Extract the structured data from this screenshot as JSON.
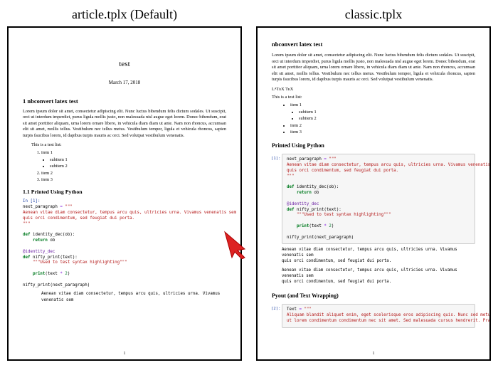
{
  "left": {
    "label": "article.tplx (Default)",
    "title": "test",
    "date": "March 17, 2018",
    "h1": "1   nbconvert latex test",
    "para": "Lorem ipsum dolor sit amet, consectetur adipiscing elit. Nunc luctus bibendum felis dictum sodales. Ut suscipit, orci ut interdum imperdiet, purus ligula mollis justo, non malesuada nisl augue eget lorem. Donec bibendum, erat sit amet porttitor aliquam, urna lorem ornare libero, in vehicula diam diam ut ante. Nam non rhoncus, accumsan elit sit amet, mollis tellus. Vestibulum nec tellus metus. Vestibulum tempor, ligula et vehicula rhoncus, sapien turpis faucibus lorem, id dapibus turpis mauris ac orci. Sed volutpat vestibulum venenatis.",
    "listLabel": "This is a test list:",
    "item1": "item 1",
    "sub1": "subitem 1",
    "sub2": "subitem 2",
    "item2": "item 2",
    "item3": "item 3",
    "h2": "1.1   Printed Using Python",
    "prompt": "In [1]:",
    "code": {
      "l01a": "next_paragraph ",
      "l01b": "=",
      "l01c": " \"\"\"",
      "l02": "Aenean vitae diam consectetur, tempus arcu quis, ultricies urna. Vivamus venenatis sem",
      "l03": "quis orci condimentum, sed feugiat dui porta.",
      "l04": "\"\"\"",
      "l06a": "def",
      "l06b": " identity_dec(ob):",
      "l07a": "    return",
      "l07b": " ob",
      "l09": "@identity_dec",
      "l10a": "def",
      "l10b": " nifty_print(text):",
      "l11": "    \"\"\"Used to test syntax highlighting\"\"\"",
      "l13a": "    print",
      "l13b": "(text ",
      "l13c": "*",
      "l13d": " ",
      "l13e": "2",
      "l13f": ")",
      "l15": "nifty_print(next_paragraph)"
    },
    "output": "Aenean vitae diam consectetur, tempus arcu quis, ultricies urna. Vivamus venenatis sem",
    "pageNum": "1"
  },
  "right": {
    "label": "classic.tplx",
    "h1": "nbconvert latex test",
    "para": "Lorem ipsum dolor sit amet, consectetur adipiscing elit. Nunc luctus bibendum felis dictum sodales. Ut suscipit, orci ut interdum imperdiet, purus ligula mollis justo, non malesuada nisl augue eget lorem. Donec bibendum, erat sit amet porttitor aliquam, urna lorem ornare libero, in vehicula diam diam ut ante. Nam non rhoncus, accumsan elit sit amet, mollis tellus. Vestibulum nec tellus metus. Vestibulum tempor, ligula et vehicula rhoncus, sapien turpis faucibus lorem, id dapibus turpis mauris ac orci. Sed volutpat vestibulum venenatis.",
    "latex": "LᴬTᴇX TᴇX",
    "listLabel": "This is a test list:",
    "item1": "item 1",
    "sub1": "subitem 1",
    "sub2": "subitem 2",
    "item2": "item 2",
    "item3": "item 3",
    "h2": "Printed Using Python",
    "prompt1": "[1]:",
    "code": {
      "l01a": "next_paragraph ",
      "l01b": "=",
      "l01c": " \"\"\"",
      "l02": "Aenean vitae diam consectetur, tempus arcu quis, ultricies urna. Vivamus venenatis sem",
      "l03": "quis orci condimentum, sed feugiat dui porta.",
      "l04": "\"\"\"",
      "l06a": "def",
      "l06b": " identity_dec(ob):",
      "l07a": "    return",
      "l07b": " ob",
      "l09": "@identity_dec",
      "l10a": "def",
      "l10b": " nifty_print(text):",
      "l11": "    \"\"\"Used to test syntax highlighting\"\"\"",
      "l13a": "    print",
      "l13b": "(text ",
      "l13c": "*",
      "l13d": " ",
      "l13e": "2",
      "l13f": ")",
      "l15": "nifty_print(next_paragraph)"
    },
    "out1": "Aenean vitae diam consectetur, tempus arcu quis, ultricies urna. Vivamus venenatis sem\nquis orci condimentum, sed feugiat dui porta.",
    "out2": "Aenean vitae diam consectetur, tempus arcu quis, ultricies urna. Vivamus venenatis sem\nquis orci condimentum, sed feugiat dui porta.",
    "h3": "Pyout (and Text Wrapping)",
    "prompt2": "[2]:",
    "code2a": "Text ",
    "code2b": "=",
    "code2c": " \"\"\"",
    "code2d": "Aliquam blandit aliquet enim, eget scelerisque eros adipiscing quis. Nunc sed metus",
    "code2e": "ut lorem condimentum condimentum nec sit amet. Sed malesuada cursus hendrerit. Praesent",
    "pageNum": "1"
  }
}
